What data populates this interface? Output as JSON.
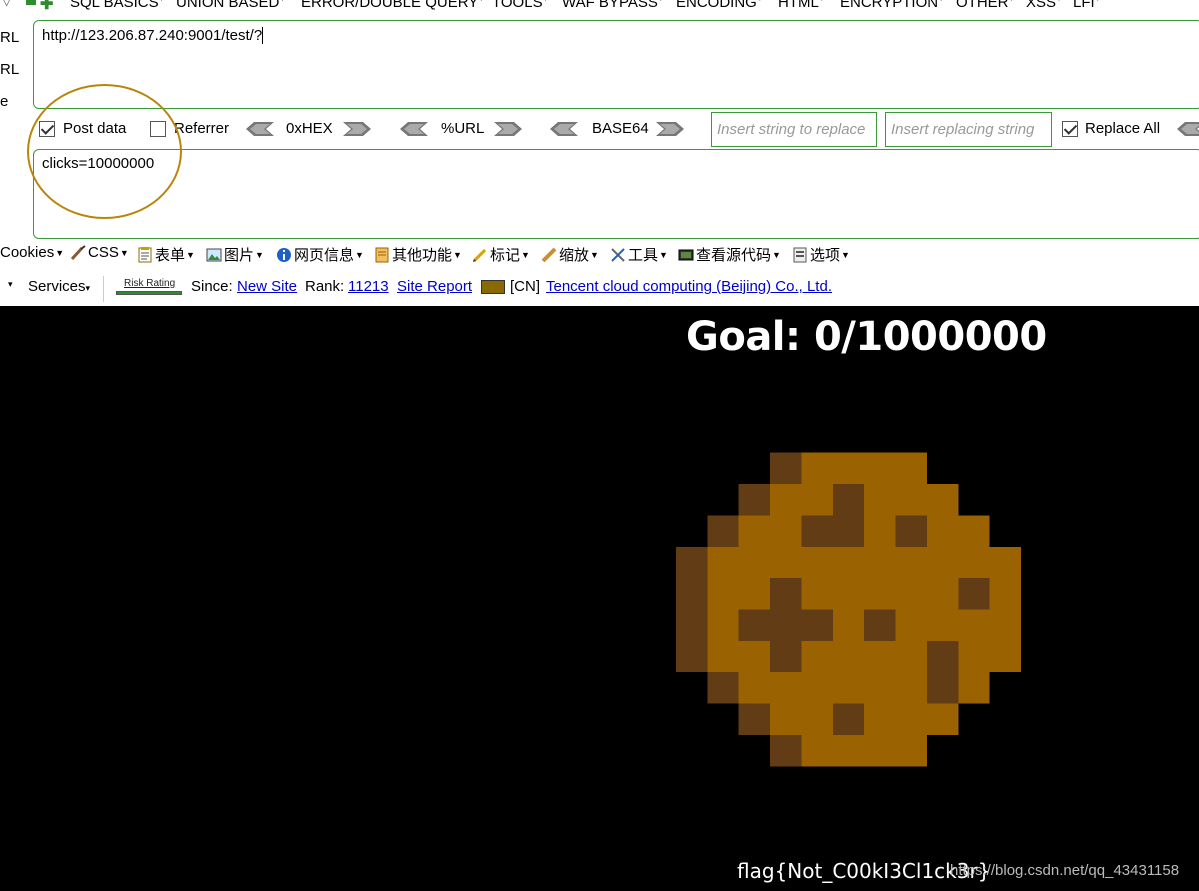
{
  "menu": {
    "items": [
      "SQL BASICS",
      "UNION BASED",
      "ERROR/DOUBLE QUERY",
      "TOOLS",
      "WAF BYPASS",
      "ENCODING",
      "HTML",
      "ENCRYPTION",
      "OTHER",
      "XSS",
      "LFI"
    ]
  },
  "side_labels": [
    "RL",
    "RL",
    "e"
  ],
  "url": {
    "value": "http://123.206.87.240:9001/test/?"
  },
  "options": {
    "post_data": {
      "label": "Post data",
      "checked": true
    },
    "referrer": {
      "label": "Referrer",
      "checked": false
    },
    "encoders": [
      "0xHEX",
      "%URL",
      "BASE64"
    ],
    "replace_input_placeholder": "Insert string to replace",
    "replacing_input_placeholder": "Insert replacing string",
    "replace_all": {
      "label": "Replace All",
      "checked": true
    }
  },
  "post": {
    "value": "clicks=10000000"
  },
  "toolbar2": {
    "items": [
      "Cookies",
      "CSS",
      "表单",
      "图片",
      "网页信息",
      "其他功能",
      "标记",
      "缩放",
      "工具",
      "查看源代码",
      "选项"
    ]
  },
  "toolbar3": {
    "services": "Services",
    "risk_label": "Risk Rating",
    "since_label": "Since:",
    "since_value": "New Site",
    "rank_label": "Rank:",
    "rank_value": "11213",
    "site_report": "Site Report",
    "country": "[CN]",
    "host": "Tencent cloud computing (Beijing) Co., Ltd."
  },
  "game": {
    "goal_text": "Goal: 0/1000000",
    "flag_text": "flag{Not_C00kI3Cl1ck3r}",
    "watermark": "https://blog.csdn.net/qq_43431158"
  },
  "colors": {
    "accent_green": "#3a9a3a",
    "annotation": "#b8860b",
    "cookie_base": "#9a6200",
    "cookie_shadow": "#623c14",
    "link": "#0000cc"
  }
}
